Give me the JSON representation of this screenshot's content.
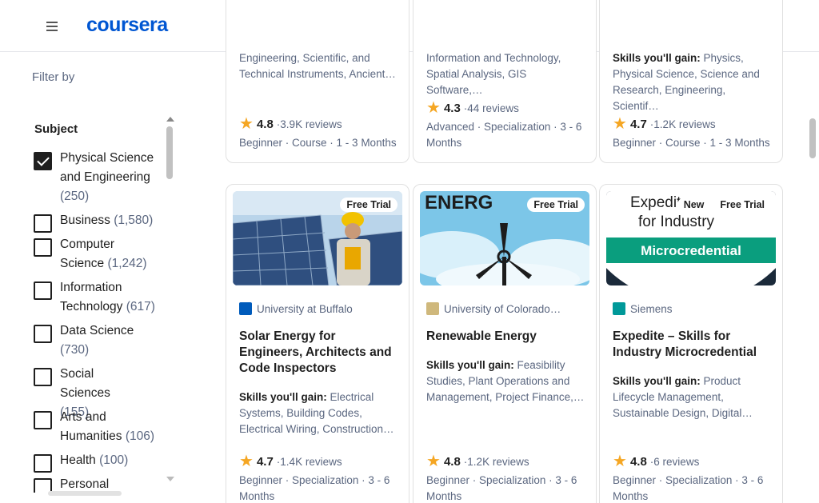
{
  "header": {
    "logo": "coursera",
    "menu_icon": "hamburger-menu-icon"
  },
  "sidebar": {
    "filter_title": "Filter by",
    "subject_title": "Subject",
    "items": [
      {
        "label": "Physical Science and Engineering",
        "count": "(250)",
        "checked": true
      },
      {
        "label": "Business",
        "count": "(1,580)",
        "checked": false
      },
      {
        "label": "Computer Science",
        "count": "(1,242)",
        "checked": false
      },
      {
        "label": "Information Technology",
        "count": "(617)",
        "checked": false
      },
      {
        "label": "Data Science",
        "count": "(730)",
        "checked": false
      },
      {
        "label": "Social Sciences",
        "count": "(155)",
        "checked": false
      },
      {
        "label": "Arts and Humanities",
        "count": "(106)",
        "checked": false
      },
      {
        "label": "Health",
        "count": "(100)",
        "checked": false
      },
      {
        "label": "Personal",
        "count": "",
        "checked": false
      }
    ]
  },
  "top_cards": [
    {
      "skills_prefix": "",
      "skills": "Engineering, Scientific, and Technical Instruments, Ancient…",
      "rating": "4.8",
      "reviews": "3.9K reviews",
      "meta": "Beginner · Course · 1 - 3 Months"
    },
    {
      "skills_prefix": "",
      "skills": "Information and Technology, Spatial Analysis, GIS Software,…",
      "rating": "4.3",
      "reviews": "44 reviews",
      "meta": "Advanced · Specialization · 3 - 6 Months"
    },
    {
      "skills_prefix": "Skills you'll gain:",
      "skills": "Physics, Physical Science, Science and Research, Engineering, Scientif…",
      "rating": "4.7",
      "reviews": "1.2K reviews",
      "meta": "Beginner · Course · 1 - 3 Months"
    }
  ],
  "cards": [
    {
      "badges": [
        "Free Trial"
      ],
      "partner": "University at Buffalo",
      "title": "Solar Energy for Engineers, Architects and Code Inspectors",
      "skills_prefix": "Skills you'll gain:",
      "skills": "Electrical Systems, Building Codes, Electrical Wiring, Construction…",
      "rating": "4.7",
      "reviews": "1.4K reviews",
      "meta": "Beginner · Specialization · 3 - 6 Months"
    },
    {
      "badges": [
        "Free Trial"
      ],
      "image_text": "ENERG",
      "partner": "University of Colorado…",
      "title": "Renewable Energy",
      "skills_prefix": "Skills you'll gain:",
      "skills": "Feasibility Studies, Plant Operations and Management, Project Finance,…",
      "rating": "4.8",
      "reviews": "1.2K reviews",
      "meta": "Beginner · Specialization · 3 - 6 Months"
    },
    {
      "badges": [
        "New",
        "Free Trial"
      ],
      "image_text_1": "Expedite",
      "image_text_2": "for Industry",
      "image_banner": "Microcredential",
      "partner": "Siemens",
      "title": "Expedite – Skills for Industry Microcredential",
      "skills_prefix": "Skills you'll gain:",
      "skills": "Product Lifecycle Management, Sustainable Design, Digital…",
      "rating": "4.8",
      "reviews": "6 reviews",
      "meta": "Beginner · Specialization · 3 - 6 Months"
    }
  ],
  "colors": {
    "brand": "#0056d2",
    "star": "#f5a623",
    "muted": "#5b6780"
  }
}
